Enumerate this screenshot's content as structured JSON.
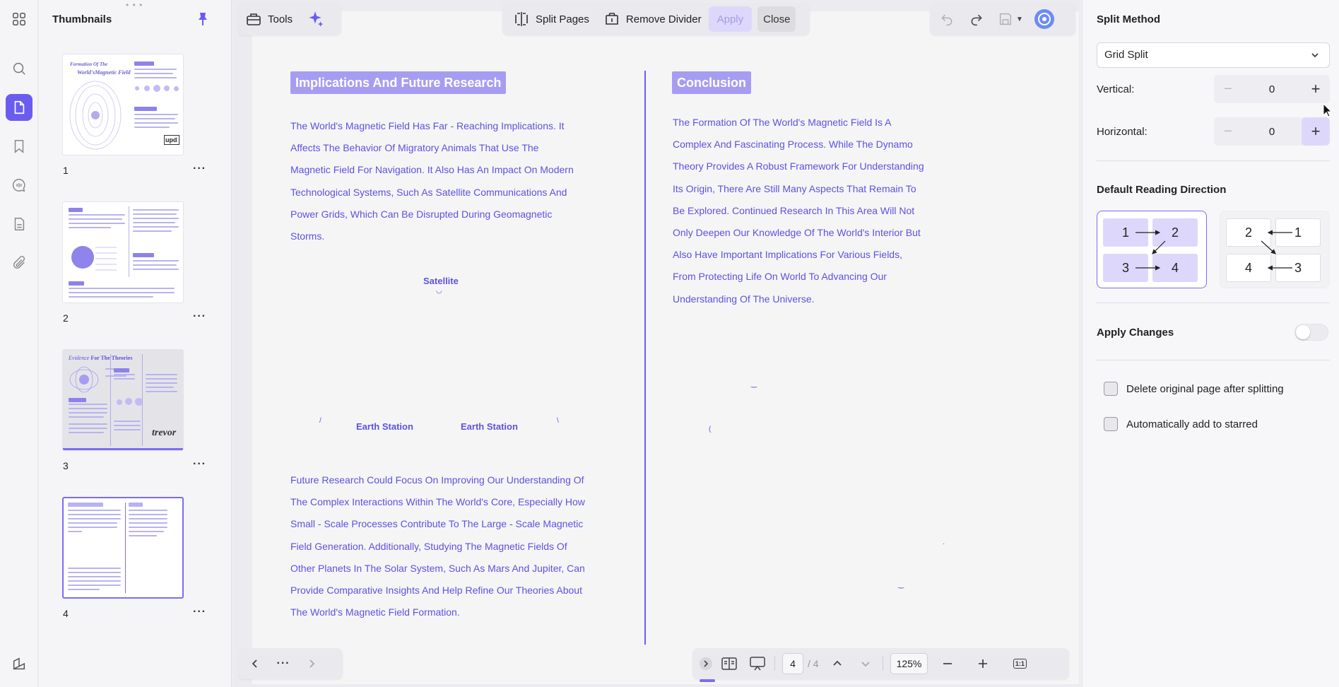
{
  "sidebar_rail": {
    "icons": [
      "apps-icon",
      "search-icon",
      "page-icon",
      "bookmark-icon",
      "comment-icon",
      "form-icon",
      "attachment-icon",
      "layers-icon"
    ]
  },
  "thumbnails": {
    "title": "Thumbnails",
    "pages": [
      {
        "number": "1",
        "title_a": "Formation Of The",
        "title_b": "World'sMagnetic Field",
        "logo": "upd"
      },
      {
        "number": "2"
      },
      {
        "number": "3",
        "title_a": "Evidence",
        "title_b": "For The Theories",
        "signature": "trevor"
      },
      {
        "number": "4"
      }
    ]
  },
  "toolbar": {
    "tools_label": "Tools",
    "split_pages_label": "Split Pages",
    "remove_divider_label": "Remove Divider",
    "apply_label": "Apply",
    "close_label": "Close"
  },
  "document": {
    "left_title": "Implications And Future Research",
    "left_para_1": [
      "The World's Magnetic Field Has Far - Reaching Implications. It",
      "Affects The Behavior Of Migratory Animals That Use The",
      "Magnetic Field For Navigation. It Also Has An Impact On Modern",
      "Technological Systems, Such As Satellite Communications And",
      "Power Grids, Which Can Be Disrupted During Geomagnetic",
      "Storms."
    ],
    "satellite_label": "Satellite",
    "earth_station_1": "Earth Station",
    "earth_station_2": "Earth Station",
    "left_para_2": [
      "Future Research Could Focus On Improving Our Understanding Of",
      "The Complex Interactions Within The World's Core, Especially How",
      "Small - Scale Processes Contribute To The Large - Scale Magnetic",
      "Field Generation. Additionally, Studying The Magnetic Fields Of",
      "Other Planets In The Solar System, Such As Mars And Jupiter, Can",
      "Provide Comparative Insights And Help Refine Our Theories About",
      "The World's Magnetic Field Formation."
    ],
    "right_title": "Conclusion",
    "right_para": [
      "The Formation Of The World's Magnetic Field Is A",
      "Complex And Fascinating Process. While The Dynamo",
      "Theory Provides A Robust Framework For Understanding",
      "Its Origin, There Are Still Many Aspects That Remain To",
      "Be Explored. Continued Research In This Area Will Not",
      "Only Deepen Our Knowledge Of The World's Interior But",
      "Also Have Important Implications For Various Fields,",
      "From Protecting Life On World To Advancing Our",
      "Understanding Of The Universe."
    ]
  },
  "bottom_nav": {
    "more_label": "···"
  },
  "bottom_view": {
    "current_page": "4",
    "total_pages": "/ 4",
    "zoom": "125%",
    "actual_size_label": "1:1"
  },
  "split_panel": {
    "method_heading": "Split Method",
    "method_value": "Grid Split",
    "vertical_label": "Vertical:",
    "vertical_value": "0",
    "horizontal_label": "Horizontal:",
    "horizontal_value": "0",
    "direction_heading": "Default Reading Direction",
    "direction_ltr": [
      "1",
      "2",
      "3",
      "4"
    ],
    "direction_rtl": [
      "2",
      "1",
      "4",
      "3"
    ],
    "apply_changes_label": "Apply Changes",
    "apply_changes_on": false,
    "delete_original_label": "Delete original page after splitting",
    "add_starred_label": "Automatically add to starred"
  },
  "colors": {
    "accent": "#6b5cf0",
    "doc_text": "#5d52e0",
    "title_chip": "#a69df2",
    "selected_fill": "#ddd8fb"
  }
}
